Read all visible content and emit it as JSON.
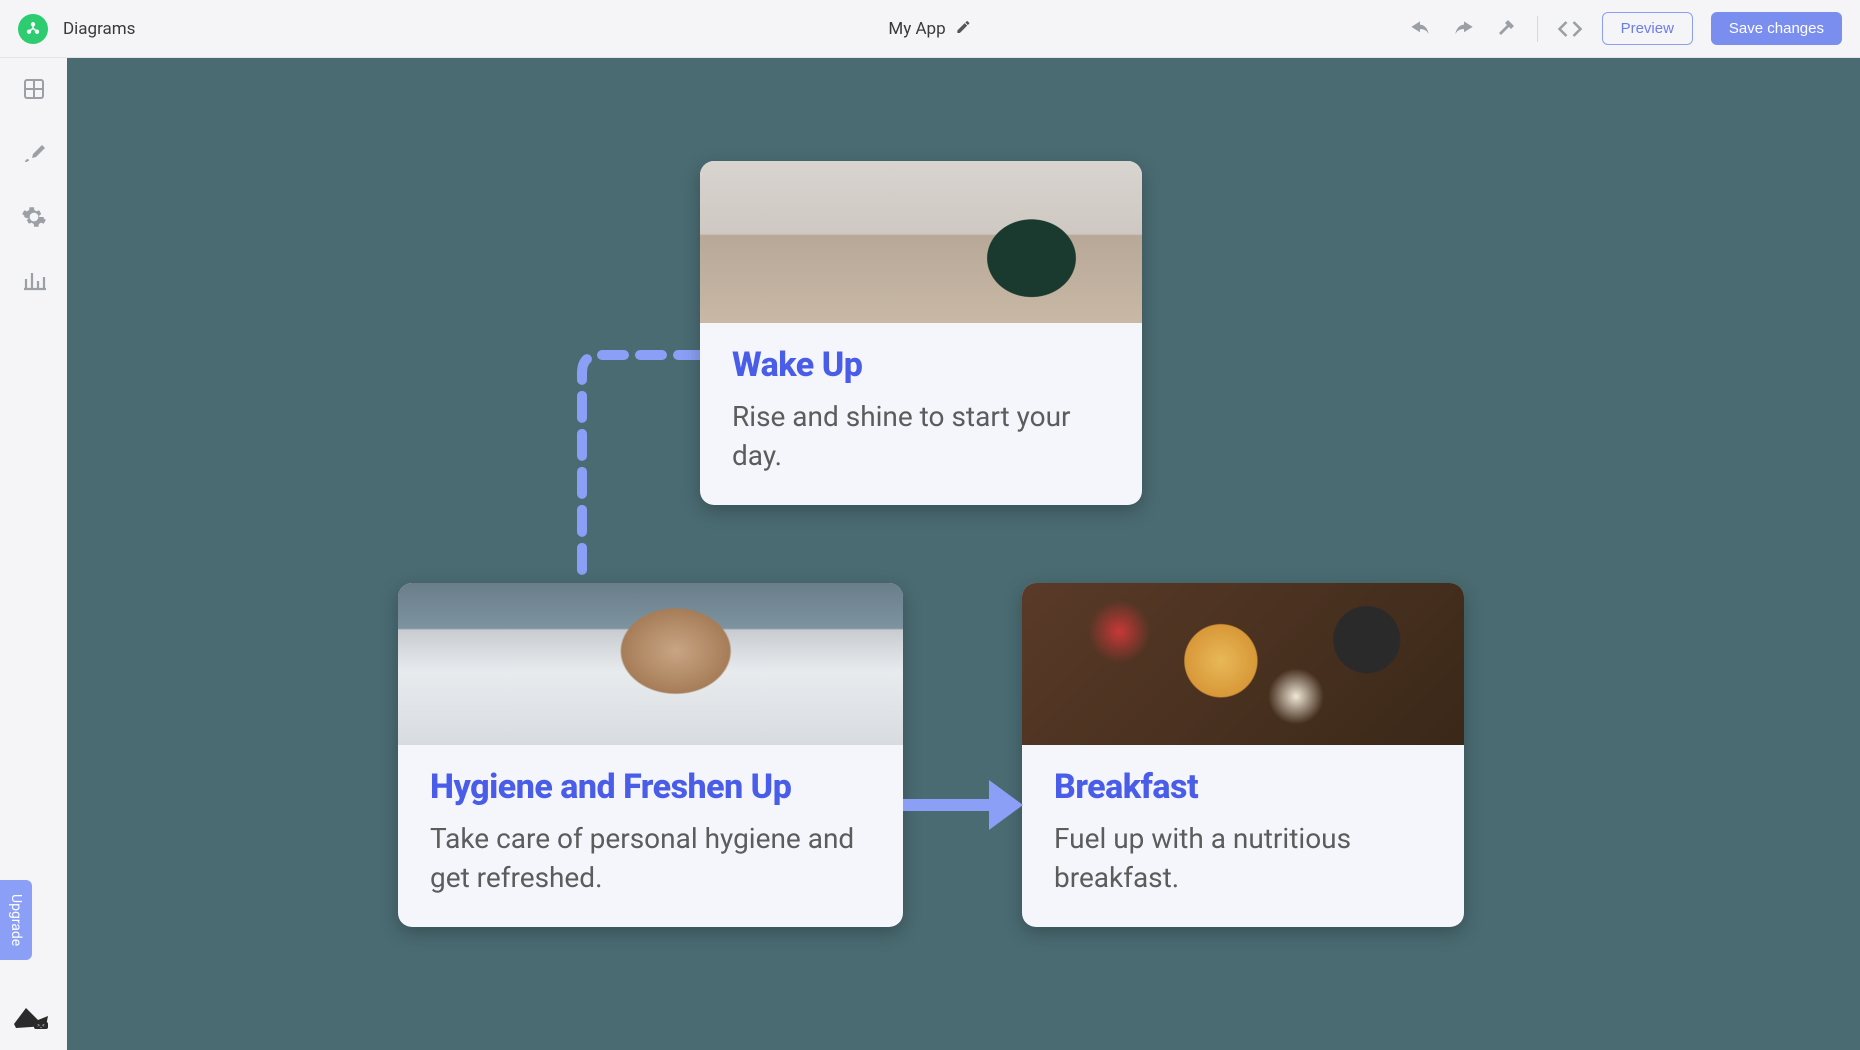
{
  "header": {
    "section_label": "Diagrams",
    "app_title": "My App",
    "preview_label": "Preview",
    "save_label": "Save changes"
  },
  "sidebar": {
    "upgrade_label": "Upgrade"
  },
  "canvas": {
    "cards": [
      {
        "title": "Wake Up",
        "desc": "Rise and shine to start your day."
      },
      {
        "title": "Hygiene and Freshen Up",
        "desc": "Take care of personal hygiene and get refreshed."
      },
      {
        "title": "Breakfast",
        "desc": "Fuel up with a nutritious breakfast."
      }
    ]
  },
  "colors": {
    "accent": "#7a8ef0",
    "canvas_bg": "#4a6b72",
    "card_title": "#4a5de8"
  }
}
